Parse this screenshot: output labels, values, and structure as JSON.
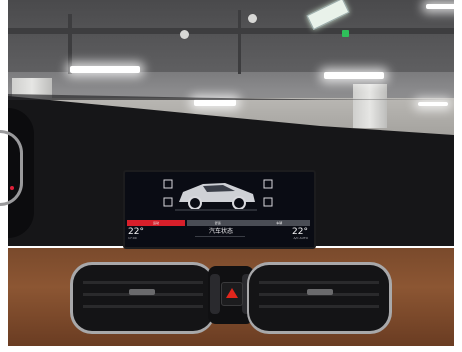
{
  "screen": {
    "tabs": [
      "运动",
      "舒适",
      "车辆"
    ],
    "mode_label": "汽车状态",
    "temp_left": "22°",
    "temp_right": "22°",
    "sub_left": "17:00",
    "sub_right": "A/C AUTO"
  },
  "colors": {
    "accent_red": "#d81f2a",
    "hazard_red": "#e2261c",
    "leather": "#8c5633",
    "exit_green": "#2fbf5a"
  },
  "icons": {
    "hazard": "hazard-triangle-icon",
    "car": "car-status-icon"
  }
}
